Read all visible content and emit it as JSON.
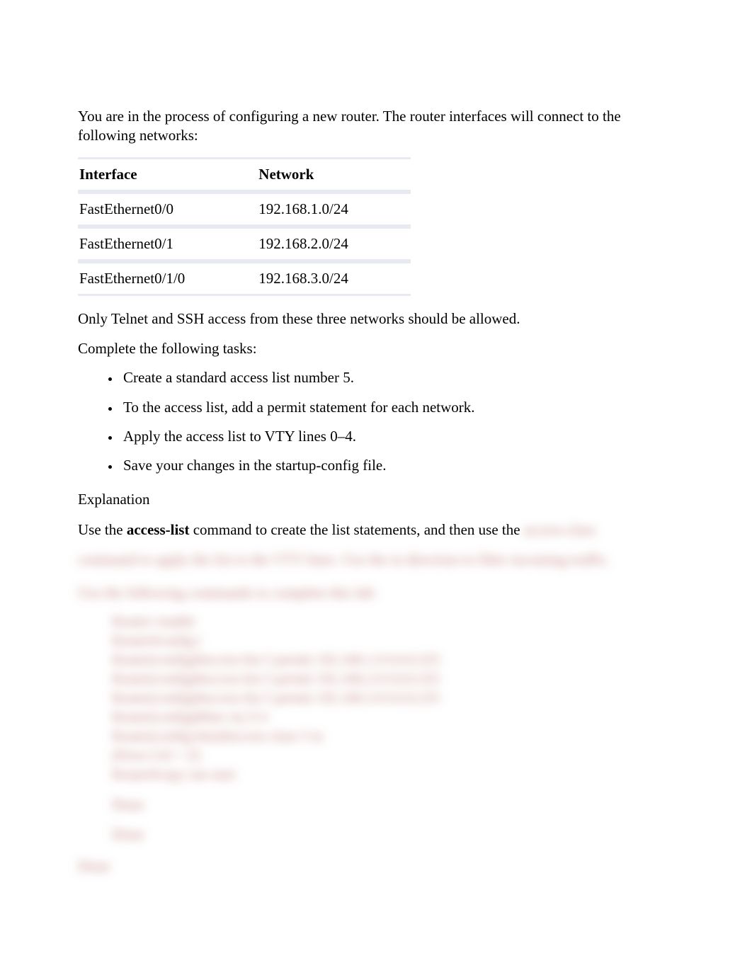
{
  "intro": "You are in the process of configuring a new router. The router interfaces will connect to the following networks:",
  "table": {
    "headers": {
      "iface": "Interface",
      "network": "Network"
    },
    "rows": [
      {
        "iface": "FastEthernet0/0",
        "network": "192.168.1.0/24"
      },
      {
        "iface": "FastEthernet0/1",
        "network": "192.168.2.0/24"
      },
      {
        "iface": "FastEthernet0/1/0",
        "network": "192.168.3.0/24"
      }
    ]
  },
  "para_allowed": "Only Telnet and SSH access from these three networks should be allowed.",
  "para_complete": "Complete the following tasks:",
  "tasks": [
    "Create a standard access list number 5.",
    "To the access list, add a permit statement for each network.",
    "Apply the access list to VTY lines 0–4.",
    "Save your changes in the startup-config file."
  ],
  "explanation_heading": "Explanation",
  "use_sentence_prefix": "Use the ",
  "use_sentence_bold": "access-list",
  "use_sentence_suffix": " command to create the list statements, and then use the ",
  "blur": {
    "inline_tail": "access-class",
    "line2": "command to apply the list to the VTY lines. Use the in direction to filter incoming traffic.",
    "heading": "Use the following commands to complete this lab:",
    "code": [
      "Router>enable",
      "Router#config t",
      "Router(config)#access-list 5 permit 192.168.1.0 0.0.0.255",
      "Router(config)#access-list 5 permit 192.168.2.0 0.0.0.255",
      "Router(config)#access-list 5 permit 192.168.3.0 0.0.0.255",
      "Router(config)#line vty 0 4",
      "Router(config-line)#access-class 5 in",
      "(Press Ctrl + Z)",
      "Router#copy run start"
    ],
    "small1": "Done",
    "small2": "Done",
    "footer": "Done"
  }
}
